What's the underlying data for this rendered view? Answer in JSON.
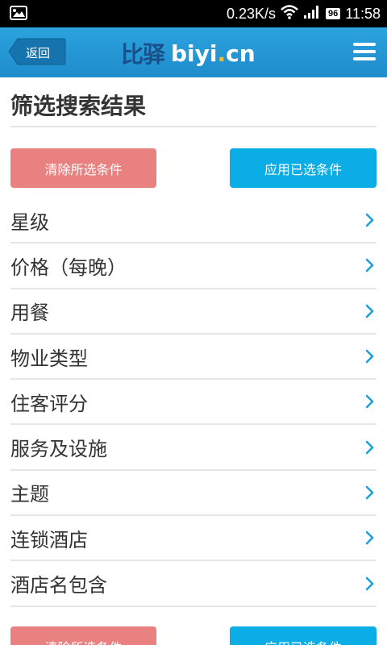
{
  "status_bar": {
    "network_speed": "0.23K/s",
    "battery": "96",
    "time": "11:58",
    "icons": [
      "image-icon",
      "wifi-icon",
      "signal-icon",
      "battery-icon"
    ]
  },
  "header": {
    "back_label": "返回",
    "logo_cn": "比驿",
    "logo_en_main": "biyi",
    "logo_en_dot": ".",
    "logo_en_tld": "cn",
    "menu_icon": "hamburger-menu-icon"
  },
  "page": {
    "title": "筛选搜索结果"
  },
  "actions": {
    "clear_label": "清除所选条件",
    "apply_label": "应用已选条件"
  },
  "filters": [
    {
      "label": "星级"
    },
    {
      "label": "价格（每晚）"
    },
    {
      "label": "用餐"
    },
    {
      "label": "物业类型"
    },
    {
      "label": "住客评分"
    },
    {
      "label": "服务及设施"
    },
    {
      "label": "主题"
    },
    {
      "label": "连锁酒店"
    },
    {
      "label": "酒店名包含"
    }
  ],
  "colors": {
    "header_blue": "#1f8ccb",
    "clear_button": "#e88180",
    "apply_button": "#0aade6",
    "chevron": "#1b9fd8"
  }
}
